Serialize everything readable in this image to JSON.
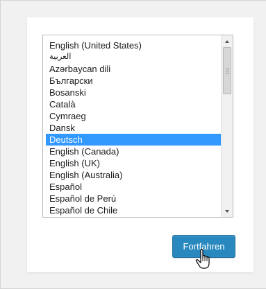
{
  "language_list": {
    "items": [
      "English (United States)",
      "العربية",
      "Azərbaycan dili",
      "Български",
      "Bosanski",
      "Català",
      "Cymraeg",
      "Dansk",
      "Deutsch",
      "English (Canada)",
      "English (UK)",
      "English (Australia)",
      "Español",
      "Español de Perú",
      "Español de Chile"
    ],
    "selected": "Deutsch"
  },
  "continue_button": {
    "label": "Fortfahren"
  },
  "colors": {
    "selection": "#3399ff",
    "button": "#2989bf",
    "background": "#f1f1f1"
  },
  "icons": {
    "cursor": "hand-pointer-icon"
  }
}
